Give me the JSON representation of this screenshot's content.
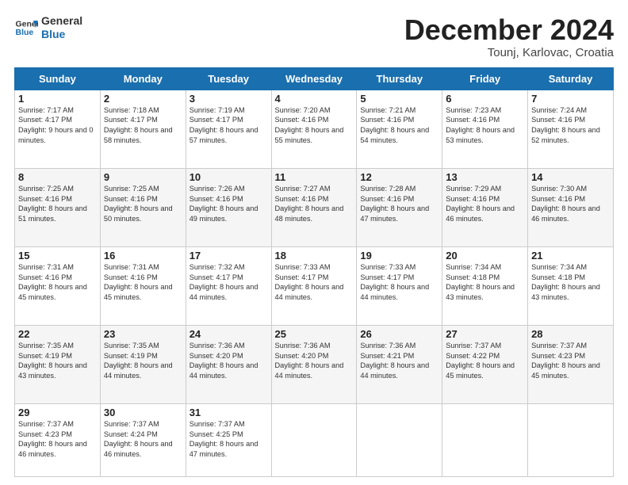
{
  "header": {
    "logo_line1": "General",
    "logo_line2": "Blue",
    "month_title": "December 2024",
    "location": "Tounj, Karlovac, Croatia"
  },
  "weekdays": [
    "Sunday",
    "Monday",
    "Tuesday",
    "Wednesday",
    "Thursday",
    "Friday",
    "Saturday"
  ],
  "weeks": [
    [
      {
        "day": "1",
        "sunrise": "7:17 AM",
        "sunset": "4:17 PM",
        "daylight": "9 hours and 0 minutes."
      },
      {
        "day": "2",
        "sunrise": "7:18 AM",
        "sunset": "4:17 PM",
        "daylight": "8 hours and 58 minutes."
      },
      {
        "day": "3",
        "sunrise": "7:19 AM",
        "sunset": "4:17 PM",
        "daylight": "8 hours and 57 minutes."
      },
      {
        "day": "4",
        "sunrise": "7:20 AM",
        "sunset": "4:16 PM",
        "daylight": "8 hours and 55 minutes."
      },
      {
        "day": "5",
        "sunrise": "7:21 AM",
        "sunset": "4:16 PM",
        "daylight": "8 hours and 54 minutes."
      },
      {
        "day": "6",
        "sunrise": "7:23 AM",
        "sunset": "4:16 PM",
        "daylight": "8 hours and 53 minutes."
      },
      {
        "day": "7",
        "sunrise": "7:24 AM",
        "sunset": "4:16 PM",
        "daylight": "8 hours and 52 minutes."
      }
    ],
    [
      {
        "day": "8",
        "sunrise": "7:25 AM",
        "sunset": "4:16 PM",
        "daylight": "8 hours and 51 minutes."
      },
      {
        "day": "9",
        "sunrise": "7:25 AM",
        "sunset": "4:16 PM",
        "daylight": "8 hours and 50 minutes."
      },
      {
        "day": "10",
        "sunrise": "7:26 AM",
        "sunset": "4:16 PM",
        "daylight": "8 hours and 49 minutes."
      },
      {
        "day": "11",
        "sunrise": "7:27 AM",
        "sunset": "4:16 PM",
        "daylight": "8 hours and 48 minutes."
      },
      {
        "day": "12",
        "sunrise": "7:28 AM",
        "sunset": "4:16 PM",
        "daylight": "8 hours and 47 minutes."
      },
      {
        "day": "13",
        "sunrise": "7:29 AM",
        "sunset": "4:16 PM",
        "daylight": "8 hours and 46 minutes."
      },
      {
        "day": "14",
        "sunrise": "7:30 AM",
        "sunset": "4:16 PM",
        "daylight": "8 hours and 46 minutes."
      }
    ],
    [
      {
        "day": "15",
        "sunrise": "7:31 AM",
        "sunset": "4:16 PM",
        "daylight": "8 hours and 45 minutes."
      },
      {
        "day": "16",
        "sunrise": "7:31 AM",
        "sunset": "4:16 PM",
        "daylight": "8 hours and 45 minutes."
      },
      {
        "day": "17",
        "sunrise": "7:32 AM",
        "sunset": "4:17 PM",
        "daylight": "8 hours and 44 minutes."
      },
      {
        "day": "18",
        "sunrise": "7:33 AM",
        "sunset": "4:17 PM",
        "daylight": "8 hours and 44 minutes."
      },
      {
        "day": "19",
        "sunrise": "7:33 AM",
        "sunset": "4:17 PM",
        "daylight": "8 hours and 44 minutes."
      },
      {
        "day": "20",
        "sunrise": "7:34 AM",
        "sunset": "4:18 PM",
        "daylight": "8 hours and 43 minutes."
      },
      {
        "day": "21",
        "sunrise": "7:34 AM",
        "sunset": "4:18 PM",
        "daylight": "8 hours and 43 minutes."
      }
    ],
    [
      {
        "day": "22",
        "sunrise": "7:35 AM",
        "sunset": "4:19 PM",
        "daylight": "8 hours and 43 minutes."
      },
      {
        "day": "23",
        "sunrise": "7:35 AM",
        "sunset": "4:19 PM",
        "daylight": "8 hours and 44 minutes."
      },
      {
        "day": "24",
        "sunrise": "7:36 AM",
        "sunset": "4:20 PM",
        "daylight": "8 hours and 44 minutes."
      },
      {
        "day": "25",
        "sunrise": "7:36 AM",
        "sunset": "4:20 PM",
        "daylight": "8 hours and 44 minutes."
      },
      {
        "day": "26",
        "sunrise": "7:36 AM",
        "sunset": "4:21 PM",
        "daylight": "8 hours and 44 minutes."
      },
      {
        "day": "27",
        "sunrise": "7:37 AM",
        "sunset": "4:22 PM",
        "daylight": "8 hours and 45 minutes."
      },
      {
        "day": "28",
        "sunrise": "7:37 AM",
        "sunset": "4:23 PM",
        "daylight": "8 hours and 45 minutes."
      }
    ],
    [
      {
        "day": "29",
        "sunrise": "7:37 AM",
        "sunset": "4:23 PM",
        "daylight": "8 hours and 46 minutes."
      },
      {
        "day": "30",
        "sunrise": "7:37 AM",
        "sunset": "4:24 PM",
        "daylight": "8 hours and 46 minutes."
      },
      {
        "day": "31",
        "sunrise": "7:37 AM",
        "sunset": "4:25 PM",
        "daylight": "8 hours and 47 minutes."
      },
      null,
      null,
      null,
      null
    ]
  ]
}
